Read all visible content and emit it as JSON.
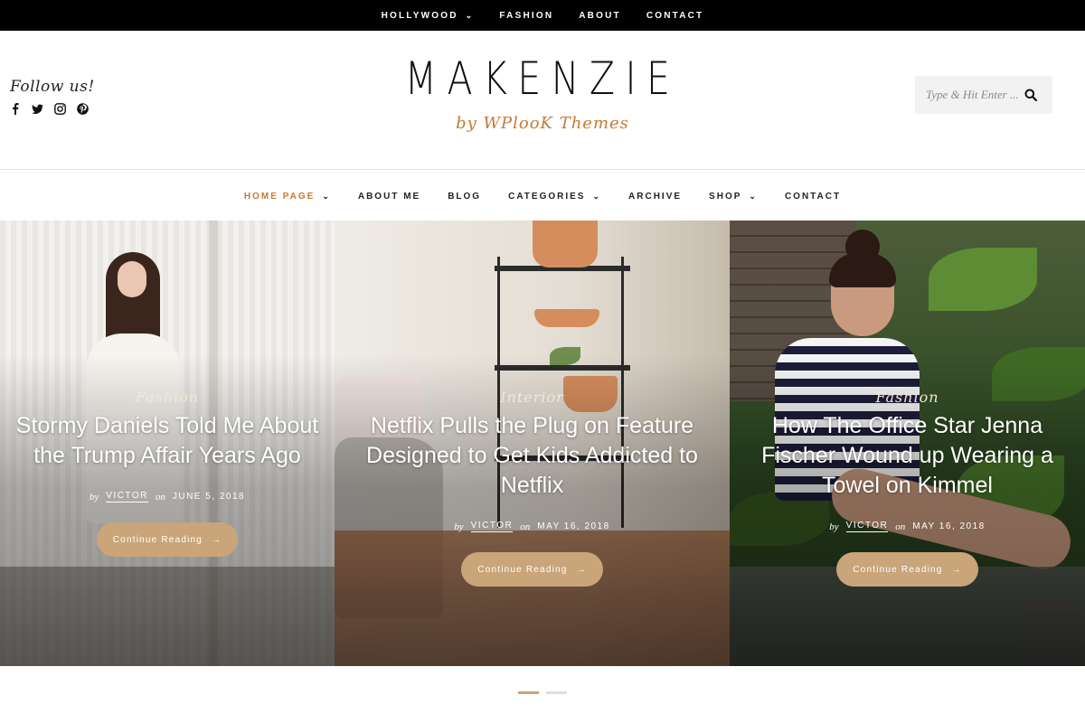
{
  "topbar": {
    "items": [
      {
        "label": "HOLLYWOOD",
        "dropdown": true
      },
      {
        "label": "FASHION",
        "dropdown": false
      },
      {
        "label": "ABOUT",
        "dropdown": false
      },
      {
        "label": "CONTACT",
        "dropdown": false
      }
    ]
  },
  "header": {
    "follow_label": "Follow us!",
    "socials": [
      "facebook-icon",
      "twitter-icon",
      "instagram-icon",
      "pinterest-icon"
    ],
    "logo": "MAKENZIE",
    "tagline": "by WPlooK Themes",
    "search": {
      "placeholder": "Type & Hit Enter ..."
    }
  },
  "nav": {
    "items": [
      {
        "label": "HOME PAGE",
        "dropdown": true,
        "active": true
      },
      {
        "label": "ABOUT ME",
        "dropdown": false
      },
      {
        "label": "BLOG",
        "dropdown": false
      },
      {
        "label": "CATEGORIES",
        "dropdown": true
      },
      {
        "label": "ARCHIVE",
        "dropdown": false
      },
      {
        "label": "SHOP",
        "dropdown": true
      },
      {
        "label": "CONTACT",
        "dropdown": false
      }
    ]
  },
  "slides": [
    {
      "category": "Fashion",
      "title": "Stormy Daniels Told Me About the Trump Affair Years Ago",
      "by": "by",
      "author": "VICTOR",
      "on": "on",
      "date": "JUNE 5, 2018",
      "button": "Continue Reading"
    },
    {
      "category": "Interior",
      "title": "Netflix Pulls the Plug on Feature Designed to Get Kids Addicted to Netflix",
      "by": "by",
      "author": "VICTOR",
      "on": "on",
      "date": "MAY 16, 2018",
      "button": "Continue Reading"
    },
    {
      "category": "Fashion",
      "title": "How The Office Star Jenna Fischer Wound up Wearing a Towel on Kimmel",
      "by": "by",
      "author": "VICTOR",
      "on": "on",
      "date": "MAY 16, 2018",
      "button": "Continue Reading"
    }
  ],
  "pagination": {
    "count": 2,
    "active": 0
  },
  "colors": {
    "accent": "#c57a33",
    "button": "#c9a579",
    "topbar": "#000000"
  },
  "icons": {
    "chevron": "chevron-down-icon",
    "arrow": "arrow-right-icon",
    "search": "search-icon"
  }
}
